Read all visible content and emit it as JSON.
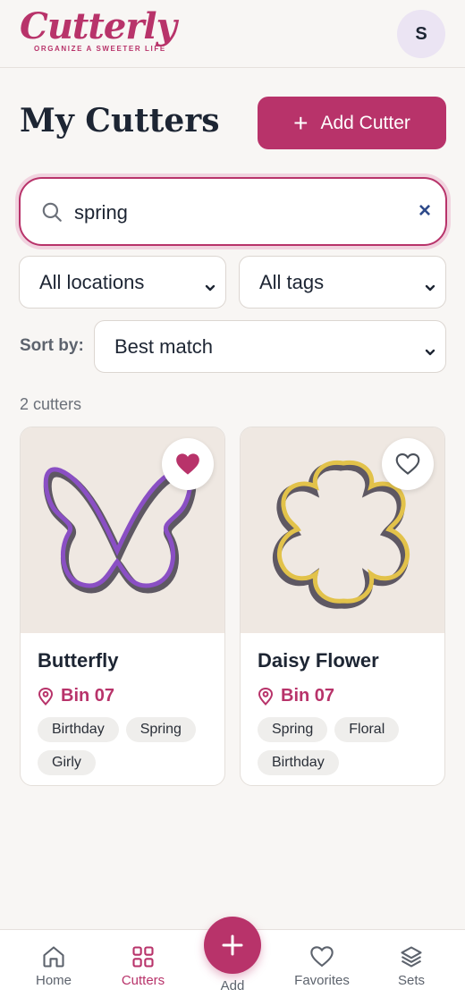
{
  "header": {
    "brand_name": "Cutterly",
    "brand_tagline": "ORGANIZE A SWEETER LIFE",
    "avatar_initial": "S"
  },
  "page": {
    "title": "My Cutters",
    "add_button_label": "Add Cutter"
  },
  "search": {
    "value": "spring",
    "clear_icon": "×"
  },
  "filters": {
    "location": "All locations",
    "tags": "All tags",
    "sort_label": "Sort by:",
    "sort_value": "Best match"
  },
  "results": {
    "count_text": "2 cutters",
    "cards": [
      {
        "name": "Butterfly",
        "bin": "Bin 07",
        "favorited": true,
        "tags": [
          "Birthday",
          "Spring",
          "Girly"
        ],
        "cutter_color": "#8a4fc4"
      },
      {
        "name": "Daisy Flower",
        "bin": "Bin 07",
        "favorited": false,
        "tags": [
          "Spring",
          "Floral",
          "Birthday"
        ],
        "cutter_color": "#e2c24a"
      }
    ]
  },
  "nav": {
    "items": [
      {
        "label": "Home",
        "icon": "home-icon"
      },
      {
        "label": "Cutters",
        "icon": "grid-icon"
      },
      {
        "label": "Add",
        "icon": "plus-icon"
      },
      {
        "label": "Favorites",
        "icon": "heart-icon"
      },
      {
        "label": "Sets",
        "icon": "layers-icon"
      }
    ],
    "active": "Cutters"
  },
  "colors": {
    "accent": "#b8336a",
    "background": "#f8f6f4",
    "text": "#1d2533"
  }
}
